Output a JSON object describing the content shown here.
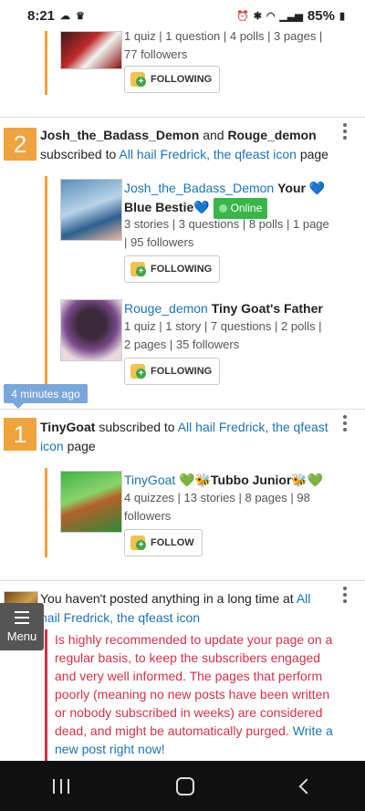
{
  "status_bar": {
    "time": "8:21",
    "battery": "85%"
  },
  "entries": {
    "top_partial": {
      "stats": "1 quiz | 1 question | 4 polls | 3 pages | 77 followers",
      "button": "FOLLOWING"
    },
    "entry2": {
      "rank": "2",
      "user1": "Josh_the_Badass_Demon",
      "and": "and",
      "user2": "Rouge_demon",
      "subscribed_to": "subscribed to",
      "page_link": "All hail Fredrick, the qfeast icon",
      "page_word": "page",
      "sub1": {
        "name": "Josh_the_Badass_Demon",
        "title": "Your 💙Blue Bestie💙",
        "online": "Online",
        "stats": "3 stories | 3 questions | 8 polls | 1 page | 95 followers",
        "button": "FOLLOWING"
      },
      "sub2": {
        "name": "Rouge_demon",
        "title": "Tiny Goat's Father",
        "stats": "1 quiz | 1 story | 7 questions | 2 polls | 2 pages | 35 followers",
        "button": "FOLLOWING"
      }
    },
    "time_badge": "4 minutes ago",
    "entry1": {
      "rank": "1",
      "user": "TinyGoat",
      "subscribed_to": "subscribed to",
      "page_link": "All hail Fredrick, the qfeast icon",
      "page_word": "page",
      "sub": {
        "name": "TinyGoat",
        "title": "💚🐝Tubbo Junior🐝💚",
        "stats": "4 quizzes | 13 stories | 8 pages | 98 followers",
        "button": "FOLLOW"
      }
    },
    "notice": {
      "text": "You haven't posted anything in a long time at",
      "page_link": "All hail Fredrick, the qfeast icon",
      "warning": "Is highly recommended to update your page on a regular basis, to keep the subscribers engaged and very well informed. The pages that perform poorly (meaning no new posts have been written or nobody subscribed in weeks) are considered dead, and might be automatically purged.",
      "cta": "Write a new post right now!"
    }
  },
  "menu_label": "Menu",
  "colors": {
    "accent_orange": "#f0a23c",
    "link_blue": "#1a73b8",
    "warning_red": "#d6304a",
    "online_green": "#39b54a"
  }
}
